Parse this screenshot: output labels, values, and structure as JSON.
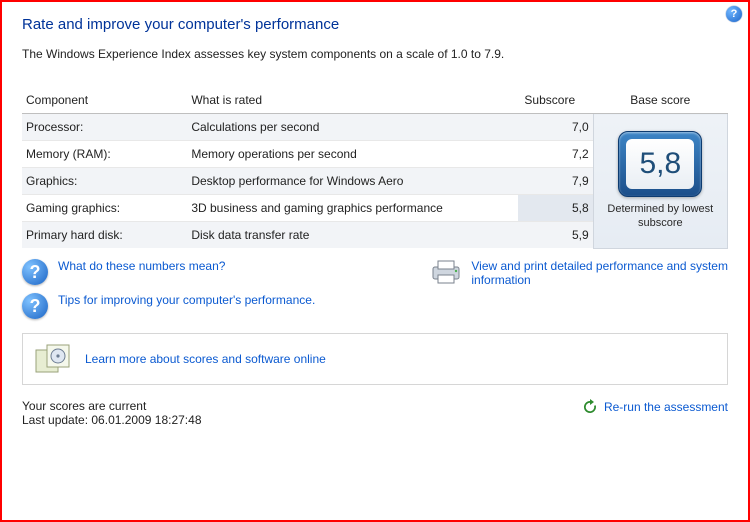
{
  "title": "Rate and improve your computer's performance",
  "subtitle": "The Windows Experience Index assesses key system components on a scale of 1.0 to 7.9.",
  "headers": {
    "component": "Component",
    "rated": "What is rated",
    "subscore": "Subscore",
    "base": "Base score"
  },
  "rows": [
    {
      "component": "Processor:",
      "rated": "Calculations per second",
      "subscore": "7,0",
      "lowest": false
    },
    {
      "component": "Memory (RAM):",
      "rated": "Memory operations per second",
      "subscore": "7,2",
      "lowest": false
    },
    {
      "component": "Graphics:",
      "rated": "Desktop performance for Windows Aero",
      "subscore": "7,9",
      "lowest": false
    },
    {
      "component": "Gaming graphics:",
      "rated": "3D business and gaming graphics performance",
      "subscore": "5,8",
      "lowest": true
    },
    {
      "component": "Primary hard disk:",
      "rated": "Disk data transfer rate",
      "subscore": "5,9",
      "lowest": false
    }
  ],
  "base_score": "5,8",
  "base_caption": "Determined by lowest subscore",
  "links": {
    "numbers_mean": "What do these numbers mean?",
    "tips": "Tips for improving your computer's performance.",
    "view_print": "View and print detailed performance and system information",
    "learn_more": "Learn more about scores and software online"
  },
  "footer": {
    "current": "Your scores are current",
    "last_update": "Last update: 06.01.2009 18:27:48",
    "rerun": "Re-run the assessment"
  }
}
